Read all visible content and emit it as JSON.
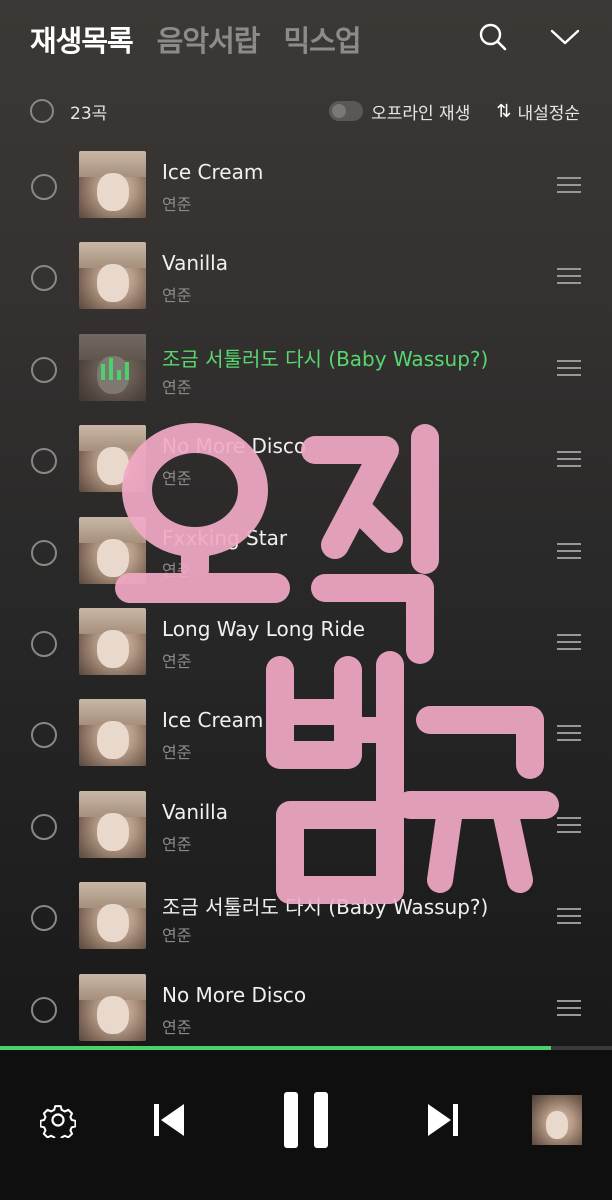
{
  "header": {
    "tabs": [
      {
        "label": "재생목록",
        "active": true
      },
      {
        "label": "음악서랍",
        "active": false
      },
      {
        "label": "믹스업",
        "active": false
      }
    ]
  },
  "toolbar": {
    "count_label": "23곡",
    "offline_label": "오프라인 재생",
    "offline_enabled": false,
    "sort_icon": "⇅",
    "sort_label": "내설정순"
  },
  "songs": [
    {
      "title": "Ice Cream",
      "artist": "연준",
      "playing": false
    },
    {
      "title": "Vanilla",
      "artist": "연준",
      "playing": false
    },
    {
      "title": "조금 서툴러도 다시 (Baby Wassup?)",
      "artist": "연준",
      "playing": true
    },
    {
      "title": "No More Disco",
      "artist": "연준",
      "playing": false
    },
    {
      "title": "Fxxking Star",
      "artist": "연준",
      "playing": false
    },
    {
      "title": "Long Way Long Ride",
      "artist": "연준",
      "playing": false
    },
    {
      "title": "Ice Cream",
      "artist": "연준",
      "playing": false
    },
    {
      "title": "Vanilla",
      "artist": "연준",
      "playing": false
    },
    {
      "title": "조금 서툴러도 다시 (Baby Wassup?)",
      "artist": "연준",
      "playing": false
    },
    {
      "title": "No More Disco",
      "artist": "연준",
      "playing": false
    }
  ],
  "overlay": {
    "text": "오직 범규"
  },
  "player": {
    "progress": 0.9,
    "state": "playing"
  },
  "colors": {
    "accent": "#4bd16a",
    "overlay_pink": "#f2a9c6"
  }
}
